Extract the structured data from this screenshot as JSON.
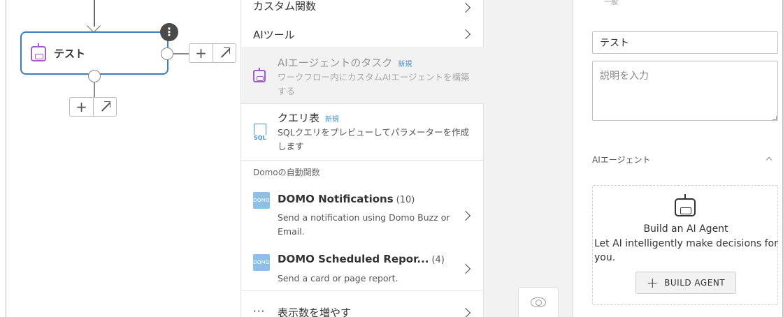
{
  "canvas": {
    "node_label": "テスト",
    "node_menu_glyph": "⋮",
    "plus_glyph": "+"
  },
  "panel": {
    "top_partial": "カスタム関数",
    "ai_tools": "AIツール",
    "ai_agent_task": {
      "title": "AIエージェントのタスク",
      "badge": "新規",
      "desc": "ワークフロー内にカスタムAIエージェントを構築する"
    },
    "query_table": {
      "title": "クエリ表",
      "badge": "新規",
      "desc": "SQLクエリをプレビューしてパラメーターを作成します",
      "icon_text": "SQL"
    },
    "section_header": "Domoの自動関数",
    "packages": [
      {
        "logo": "DOMO",
        "title": "DOMO Notifications",
        "count": "(10)",
        "desc": "Send a notification using Domo Buzz or Email."
      },
      {
        "logo": "DOMO",
        "title": "DOMO Scheduled Repor...",
        "count": "(4)",
        "desc": "Send a card or page report."
      }
    ],
    "more": {
      "dots": "···",
      "label": "表示数を増やす"
    }
  },
  "right": {
    "tiny_label": "一般",
    "name_value": "テスト",
    "description_placeholder": "説明を入力",
    "ai_agent_header": "AIエージェント",
    "agent_box": {
      "title": "Build an AI Agent",
      "desc": "Let AI intelligently make decisions for you.",
      "button_label": "BUILD AGENT",
      "button_plus": "+"
    }
  },
  "colors": {
    "node_border": "#3f7fb6",
    "agent_purple": "#a05fc0",
    "badge_blue": "#4a90c8",
    "domo_logo": "#8ec0e6"
  }
}
